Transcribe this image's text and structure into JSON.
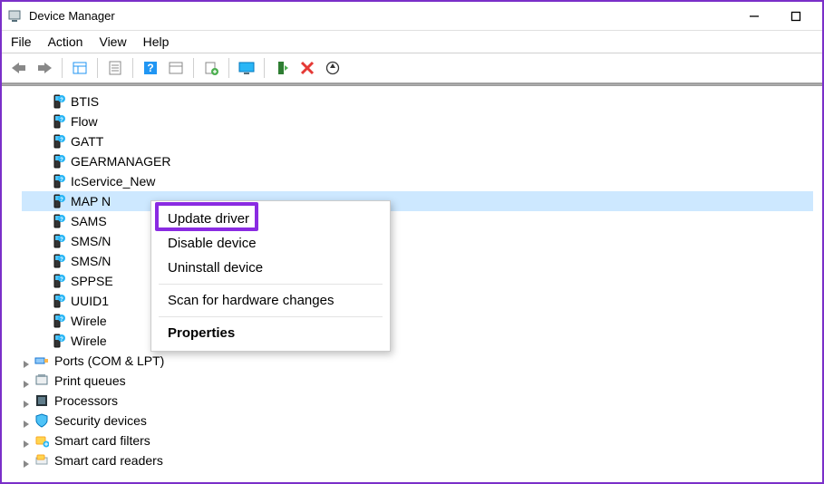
{
  "window": {
    "title": "Device Manager"
  },
  "menubar": {
    "file": "File",
    "action": "Action",
    "view": "View",
    "help": "Help"
  },
  "devices": [
    {
      "label": "BTIS"
    },
    {
      "label": "Flow"
    },
    {
      "label": "GATT"
    },
    {
      "label": "GEARMANAGER"
    },
    {
      "label": "IcService_New"
    },
    {
      "label": "MAP N",
      "selected": true
    },
    {
      "label": "SAMS"
    },
    {
      "label": "SMS/N"
    },
    {
      "label": "SMS/N"
    },
    {
      "label": "SPPSE"
    },
    {
      "label": "UUID1"
    },
    {
      "label": "Wirele"
    },
    {
      "label": "Wirele"
    }
  ],
  "categories": [
    {
      "label": "Ports (COM & LPT)"
    },
    {
      "label": "Print queues"
    },
    {
      "label": "Processors"
    },
    {
      "label": "Security devices"
    },
    {
      "label": "Smart card filters"
    },
    {
      "label": "Smart card readers"
    }
  ],
  "context_menu": {
    "update": "Update driver",
    "disable": "Disable device",
    "uninstall": "Uninstall device",
    "scan": "Scan for hardware changes",
    "properties": "Properties"
  }
}
